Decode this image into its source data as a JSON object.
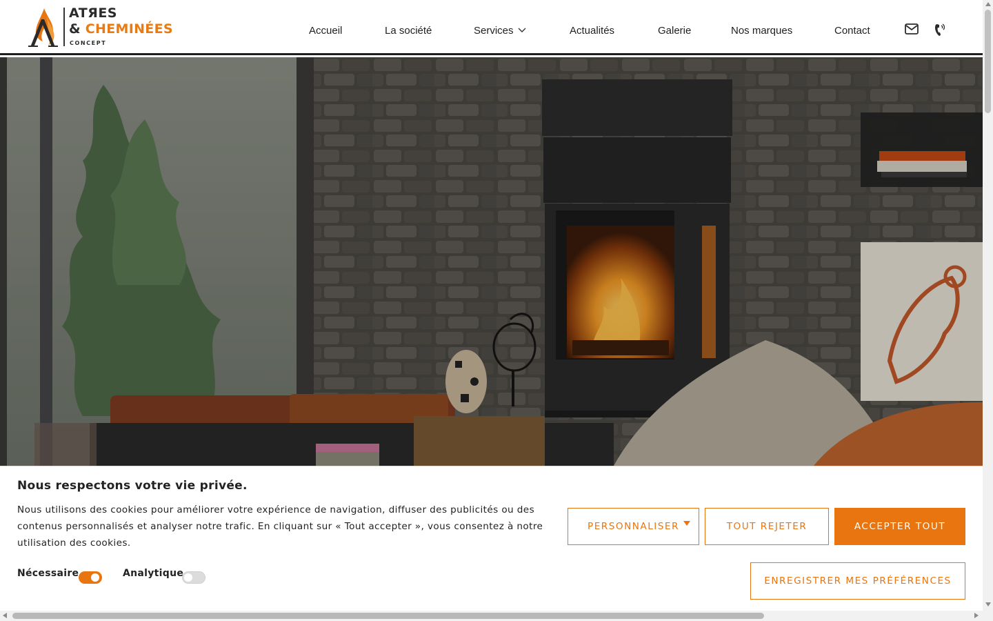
{
  "brand": {
    "line1": "ATЯES",
    "line2_prefix": "& ",
    "line2_accent": "CHEMINÉES",
    "line3": "CONCEPT",
    "accent_color": "#e8750f"
  },
  "nav": {
    "items": [
      {
        "label": "Accueil"
      },
      {
        "label": "La société"
      },
      {
        "label": "Services",
        "has_dropdown": true
      },
      {
        "label": "Actualités"
      },
      {
        "label": "Galerie"
      },
      {
        "label": "Nos marques"
      },
      {
        "label": "Contact"
      }
    ],
    "icons": [
      "mail-icon",
      "phone-icon"
    ]
  },
  "hero": {
    "image": "living-room-stove-photo"
  },
  "cookie": {
    "title": "Nous respectons votre vie privée.",
    "text": "Nous utilisons des cookies pour améliorer votre expérience de navigation, diffuser des publicités ou des contenus personnalisés et analyser notre trafic. En cliquant sur « Tout accepter », vous consentez à notre utilisation des cookies.",
    "toggles": [
      {
        "label": "Nécessaire",
        "on": true
      },
      {
        "label": "Analytique",
        "on": false
      }
    ],
    "buttons": {
      "customize": "PERSONNALISER",
      "reject": "TOUT REJETER",
      "accept": "ACCEPTER TOUT",
      "save": "ENREGISTRER MES PRÉFÉRENCES"
    }
  }
}
